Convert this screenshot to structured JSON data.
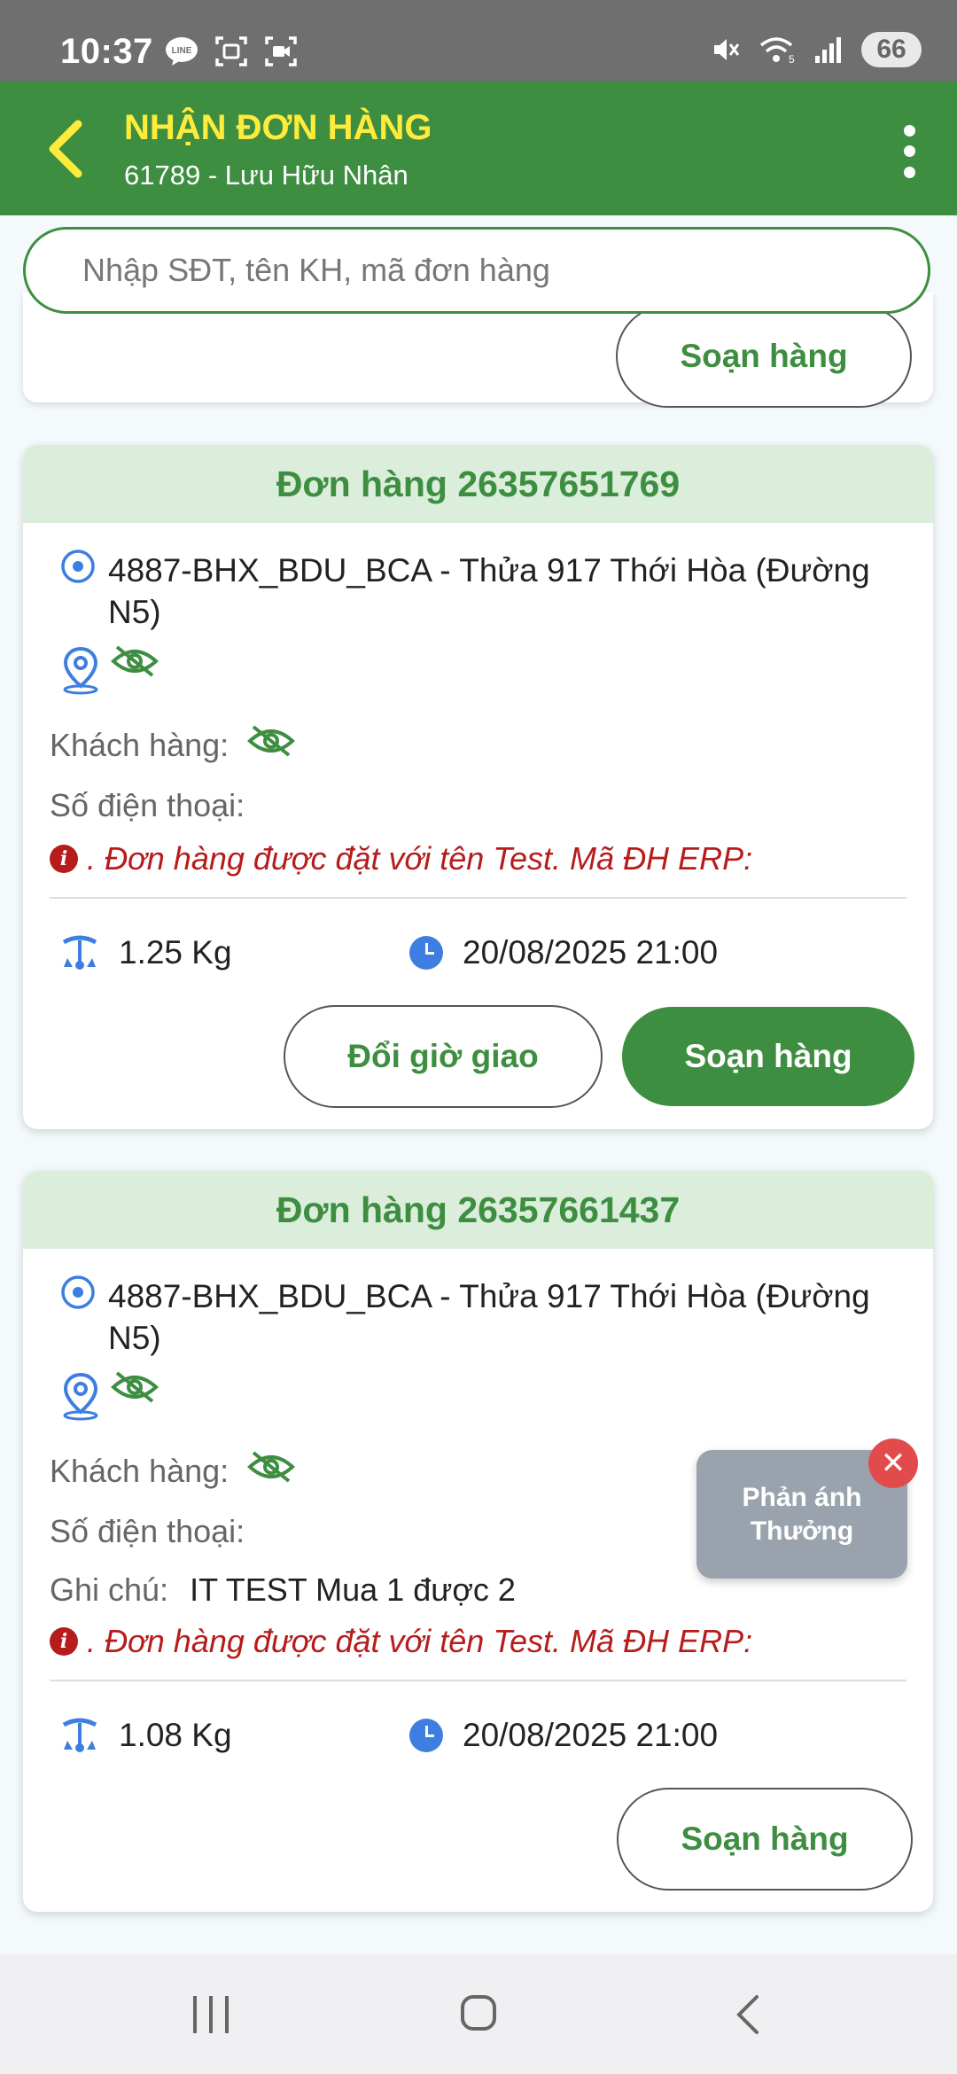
{
  "status_bar": {
    "time": "10:37",
    "battery": "66",
    "left_icons": [
      "line-icon",
      "screenshot-icon",
      "screen-record-icon"
    ],
    "right_icons": [
      "mute-icon",
      "wifi-icon",
      "signal-icon"
    ]
  },
  "header": {
    "title": "NHẬN ĐƠN HÀNG",
    "subtitle": "61789 - Lưu Hữu Nhân",
    "title_color": "#ffeb3b",
    "background_color": "#3e8e41"
  },
  "search": {
    "placeholder": "Nhập SĐT, tên KH, mã đơn hàng"
  },
  "partial_card": {
    "button_label": "Soạn hàng"
  },
  "orders": [
    {
      "title": "Đơn hàng 26357651769",
      "address": "4887-BHX_BDU_BCA - Thửa 917 Thới Hòa (Đường N5)",
      "customer_label": "Khách hàng:",
      "phone_label": "Số điện thoại:",
      "warning": ". Đơn hàng được đặt với tên Test. Mã ĐH ERP:",
      "weight": "1.25 Kg",
      "time": "20/08/2025 21:00",
      "change_time_label": "Đổi giờ giao",
      "prepare_label": "Soạn hàng"
    },
    {
      "title": "Đơn hàng 26357661437",
      "address": "4887-BHX_BDU_BCA - Thửa 917 Thới Hòa (Đường N5)",
      "customer_label": "Khách hàng:",
      "phone_label": "Số điện thoại:",
      "note_label": "Ghi chú:",
      "note_value": "IT TEST Mua 1 được 2",
      "warning": ". Đơn hàng được đặt với tên Test. Mã ĐH ERP:",
      "weight": "1.08 Kg",
      "time": "20/08/2025 21:00",
      "prepare_label": "Soạn hàng"
    }
  ],
  "floating_feedback": {
    "line1": "Phản ánh",
    "line2": "Thưởng",
    "close_symbol": "✕"
  },
  "colors": {
    "accent": "#3e8e41",
    "card_header": "#daeedb",
    "warning": "#b71c1c",
    "icon_blue": "#3d7ee0"
  }
}
